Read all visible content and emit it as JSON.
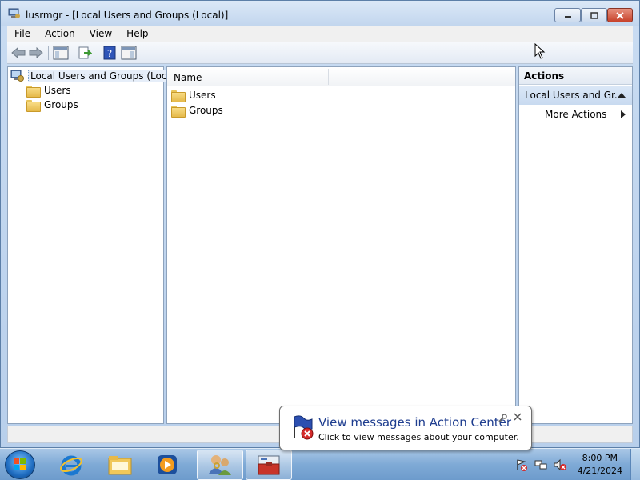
{
  "window": {
    "title": "lusrmgr - [Local Users and Groups (Local)]"
  },
  "menu": [
    "File",
    "Action",
    "View",
    "Help"
  ],
  "tree": {
    "root": "Local Users and Groups (Local)",
    "children": [
      "Users",
      "Groups"
    ]
  },
  "center": {
    "column_name": "Name",
    "items": [
      "Users",
      "Groups"
    ]
  },
  "actions": {
    "title": "Actions",
    "section": "Local Users and Gr...",
    "more": "More Actions"
  },
  "balloon": {
    "title": "View messages in Action Center",
    "text": "Click to view messages about your computer."
  },
  "clock": {
    "time": "8:00 PM",
    "date": "4/21/2024"
  },
  "colors": {
    "taskbar": "#7faad6",
    "balloon_title": "#1e3d8f",
    "close_button": "#c7412a"
  }
}
